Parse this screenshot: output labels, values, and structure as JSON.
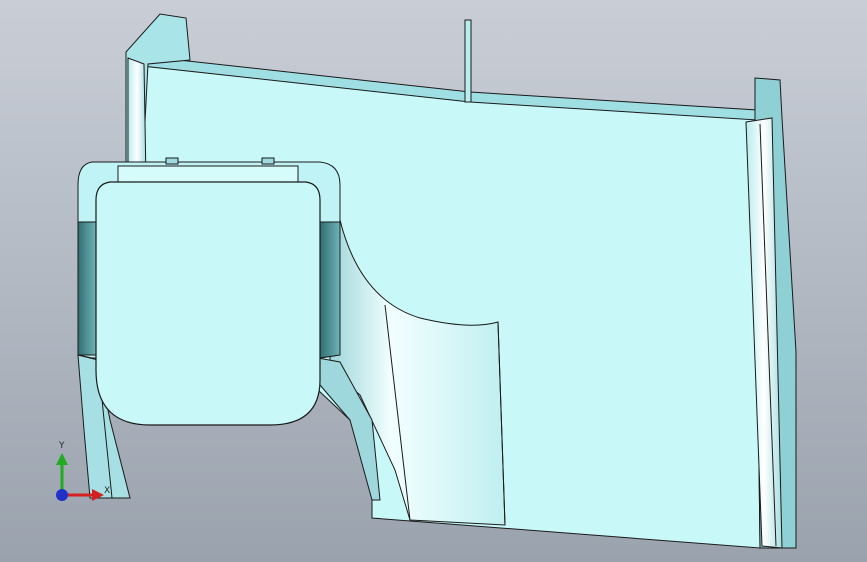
{
  "viewport": {
    "background_top": "#c9ced6",
    "background_bottom": "#9aa2ad"
  },
  "model": {
    "face_color": "#c8f8f8",
    "shade_color": "#7fc6cc",
    "dark_color": "#3f8488",
    "edge_color": "#1a1a1a"
  },
  "triad": {
    "y_label": "Y",
    "x_label": "X",
    "y_color": "#22aa22",
    "x_color": "#d42020",
    "z_color": "#2030c8"
  }
}
